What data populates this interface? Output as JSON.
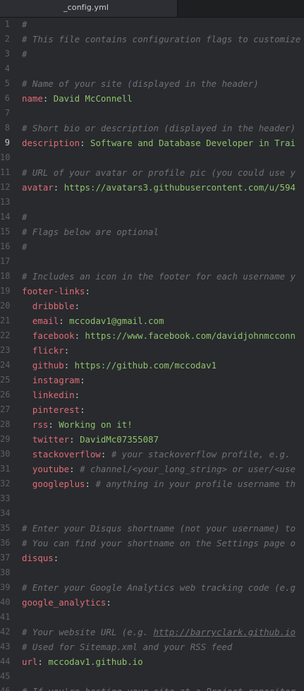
{
  "tab": {
    "label": "_config.yml"
  },
  "lines": [
    {
      "n": "1",
      "parts": [
        {
          "t": "#",
          "c": "cmt"
        }
      ]
    },
    {
      "n": "2",
      "parts": [
        {
          "t": "# This file contains configuration flags to customize",
          "c": "cmt"
        }
      ]
    },
    {
      "n": "3",
      "parts": [
        {
          "t": "#",
          "c": "cmt"
        }
      ]
    },
    {
      "n": "4",
      "parts": []
    },
    {
      "n": "5",
      "parts": [
        {
          "t": "# Name of your site (displayed in the header)",
          "c": "cmt"
        }
      ]
    },
    {
      "n": "6",
      "parts": [
        {
          "t": "name",
          "c": "key"
        },
        {
          "t": ": ",
          "c": "punc"
        },
        {
          "t": "David McConnell",
          "c": "val"
        }
      ]
    },
    {
      "n": "7",
      "parts": []
    },
    {
      "n": "8",
      "parts": [
        {
          "t": "# Short bio or description (displayed in the header)",
          "c": "cmt"
        }
      ]
    },
    {
      "n": "9",
      "active": true,
      "parts": [
        {
          "t": "description",
          "c": "key"
        },
        {
          "t": ": ",
          "c": "punc"
        },
        {
          "t": "Software and Database Developer in Trai",
          "c": "val"
        }
      ]
    },
    {
      "n": "10",
      "parts": []
    },
    {
      "n": "11",
      "parts": [
        {
          "t": "# URL of your avatar or profile pic (you could use y",
          "c": "cmt"
        }
      ]
    },
    {
      "n": "12",
      "parts": [
        {
          "t": "avatar",
          "c": "key"
        },
        {
          "t": ": ",
          "c": "punc"
        },
        {
          "t": "https://avatars3.githubusercontent.com/u/594",
          "c": "val"
        }
      ]
    },
    {
      "n": "13",
      "parts": []
    },
    {
      "n": "14",
      "parts": [
        {
          "t": "#",
          "c": "cmt"
        }
      ]
    },
    {
      "n": "15",
      "parts": [
        {
          "t": "# Flags below are optional",
          "c": "cmt"
        }
      ]
    },
    {
      "n": "16",
      "parts": [
        {
          "t": "#",
          "c": "cmt"
        }
      ]
    },
    {
      "n": "17",
      "parts": []
    },
    {
      "n": "18",
      "parts": [
        {
          "t": "# Includes an icon in the footer for each username y",
          "c": "cmt"
        }
      ]
    },
    {
      "n": "19",
      "parts": [
        {
          "t": "footer-links",
          "c": "key"
        },
        {
          "t": ":",
          "c": "punc"
        }
      ]
    },
    {
      "n": "20",
      "parts": [
        {
          "t": "  dribbble",
          "c": "key"
        },
        {
          "t": ":",
          "c": "punc"
        }
      ]
    },
    {
      "n": "21",
      "parts": [
        {
          "t": "  email",
          "c": "key"
        },
        {
          "t": ": ",
          "c": "punc"
        },
        {
          "t": "mccodav1@gmail.com",
          "c": "val"
        }
      ]
    },
    {
      "n": "22",
      "parts": [
        {
          "t": "  facebook",
          "c": "key"
        },
        {
          "t": ": ",
          "c": "punc"
        },
        {
          "t": "https://www.facebook.com/davidjohnmcconn",
          "c": "val"
        }
      ]
    },
    {
      "n": "23",
      "parts": [
        {
          "t": "  flickr",
          "c": "key"
        },
        {
          "t": ":",
          "c": "punc"
        }
      ]
    },
    {
      "n": "24",
      "parts": [
        {
          "t": "  github",
          "c": "key"
        },
        {
          "t": ": ",
          "c": "punc"
        },
        {
          "t": "https://github.com/mccodav1",
          "c": "val"
        }
      ]
    },
    {
      "n": "25",
      "parts": [
        {
          "t": "  instagram",
          "c": "key"
        },
        {
          "t": ":",
          "c": "punc"
        }
      ]
    },
    {
      "n": "26",
      "parts": [
        {
          "t": "  linkedin",
          "c": "key"
        },
        {
          "t": ":",
          "c": "punc"
        }
      ]
    },
    {
      "n": "27",
      "parts": [
        {
          "t": "  pinterest",
          "c": "key"
        },
        {
          "t": ":",
          "c": "punc"
        }
      ]
    },
    {
      "n": "28",
      "parts": [
        {
          "t": "  rss",
          "c": "key"
        },
        {
          "t": ": ",
          "c": "punc"
        },
        {
          "t": "Working on it!",
          "c": "val"
        }
      ]
    },
    {
      "n": "29",
      "parts": [
        {
          "t": "  twitter",
          "c": "key"
        },
        {
          "t": ": ",
          "c": "punc"
        },
        {
          "t": "DavidMc07355087",
          "c": "val"
        }
      ]
    },
    {
      "n": "30",
      "parts": [
        {
          "t": "  stackoverflow",
          "c": "key"
        },
        {
          "t": ": ",
          "c": "punc"
        },
        {
          "t": "# your stackoverflow profile, e.g. ",
          "c": "cmt"
        }
      ]
    },
    {
      "n": "31",
      "parts": [
        {
          "t": "  youtube",
          "c": "key"
        },
        {
          "t": ": ",
          "c": "punc"
        },
        {
          "t": "# channel/<your_long_string> or user/<use",
          "c": "cmt"
        }
      ]
    },
    {
      "n": "32",
      "parts": [
        {
          "t": "  googleplus",
          "c": "key"
        },
        {
          "t": ": ",
          "c": "punc"
        },
        {
          "t": "# anything in your profile username th",
          "c": "cmt"
        }
      ]
    },
    {
      "n": "33",
      "parts": []
    },
    {
      "n": "34",
      "parts": []
    },
    {
      "n": "35",
      "parts": [
        {
          "t": "# Enter your Disqus shortname (not your username) to",
          "c": "cmt"
        }
      ]
    },
    {
      "n": "36",
      "parts": [
        {
          "t": "# You can find your shortname on the Settings page o",
          "c": "cmt"
        }
      ]
    },
    {
      "n": "37",
      "parts": [
        {
          "t": "disqus",
          "c": "key"
        },
        {
          "t": ":",
          "c": "punc"
        }
      ]
    },
    {
      "n": "38",
      "parts": []
    },
    {
      "n": "39",
      "parts": [
        {
          "t": "# Enter your Google Analytics web tracking code (e.g",
          "c": "cmt"
        }
      ]
    },
    {
      "n": "40",
      "parts": [
        {
          "t": "google_analytics",
          "c": "key"
        },
        {
          "t": ":",
          "c": "punc"
        }
      ]
    },
    {
      "n": "41",
      "parts": []
    },
    {
      "n": "42",
      "parts": [
        {
          "t": "# Your website URL (e.g. ",
          "c": "cmt"
        },
        {
          "t": "http://barryclark.github.io",
          "c": "cmt-link"
        }
      ]
    },
    {
      "n": "43",
      "parts": [
        {
          "t": "# Used for Sitemap.xml and your RSS feed",
          "c": "cmt"
        }
      ]
    },
    {
      "n": "44",
      "parts": [
        {
          "t": "url",
          "c": "key"
        },
        {
          "t": ": ",
          "c": "punc"
        },
        {
          "t": "mccodav1.github.io",
          "c": "val"
        }
      ]
    },
    {
      "n": "45",
      "parts": []
    },
    {
      "n": "46",
      "parts": [
        {
          "t": "# If you're hosting your site at a Project repositor",
          "c": "cmt"
        }
      ]
    }
  ]
}
